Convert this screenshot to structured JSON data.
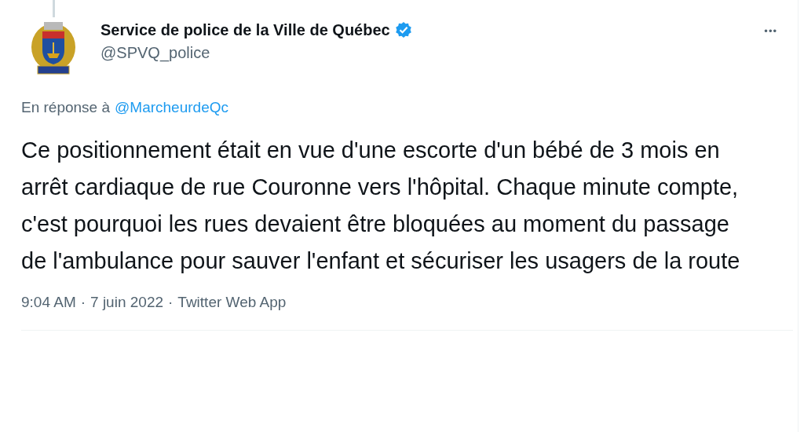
{
  "author": {
    "name": "Service de police de la Ville de Québec",
    "verified": true,
    "handle": "@SPVQ_police"
  },
  "more_button": "•••",
  "reply_to": {
    "prefix": "En réponse à",
    "mention": "@MarcheurdeQc"
  },
  "text": "Ce positionnement était en vue d'une escorte d'un bébé de 3 mois en arrêt cardiaque de rue Couronne vers l'hôpital. Chaque minute compte, c'est pourquoi les rues devaient être bloquées au moment du passage de l'ambulance pour sauver l'enfant et sécuriser les usagers de la route",
  "meta": [
    "9:04 AM",
    "·",
    "7 juin 2022",
    "·",
    "Twitter Web App"
  ]
}
